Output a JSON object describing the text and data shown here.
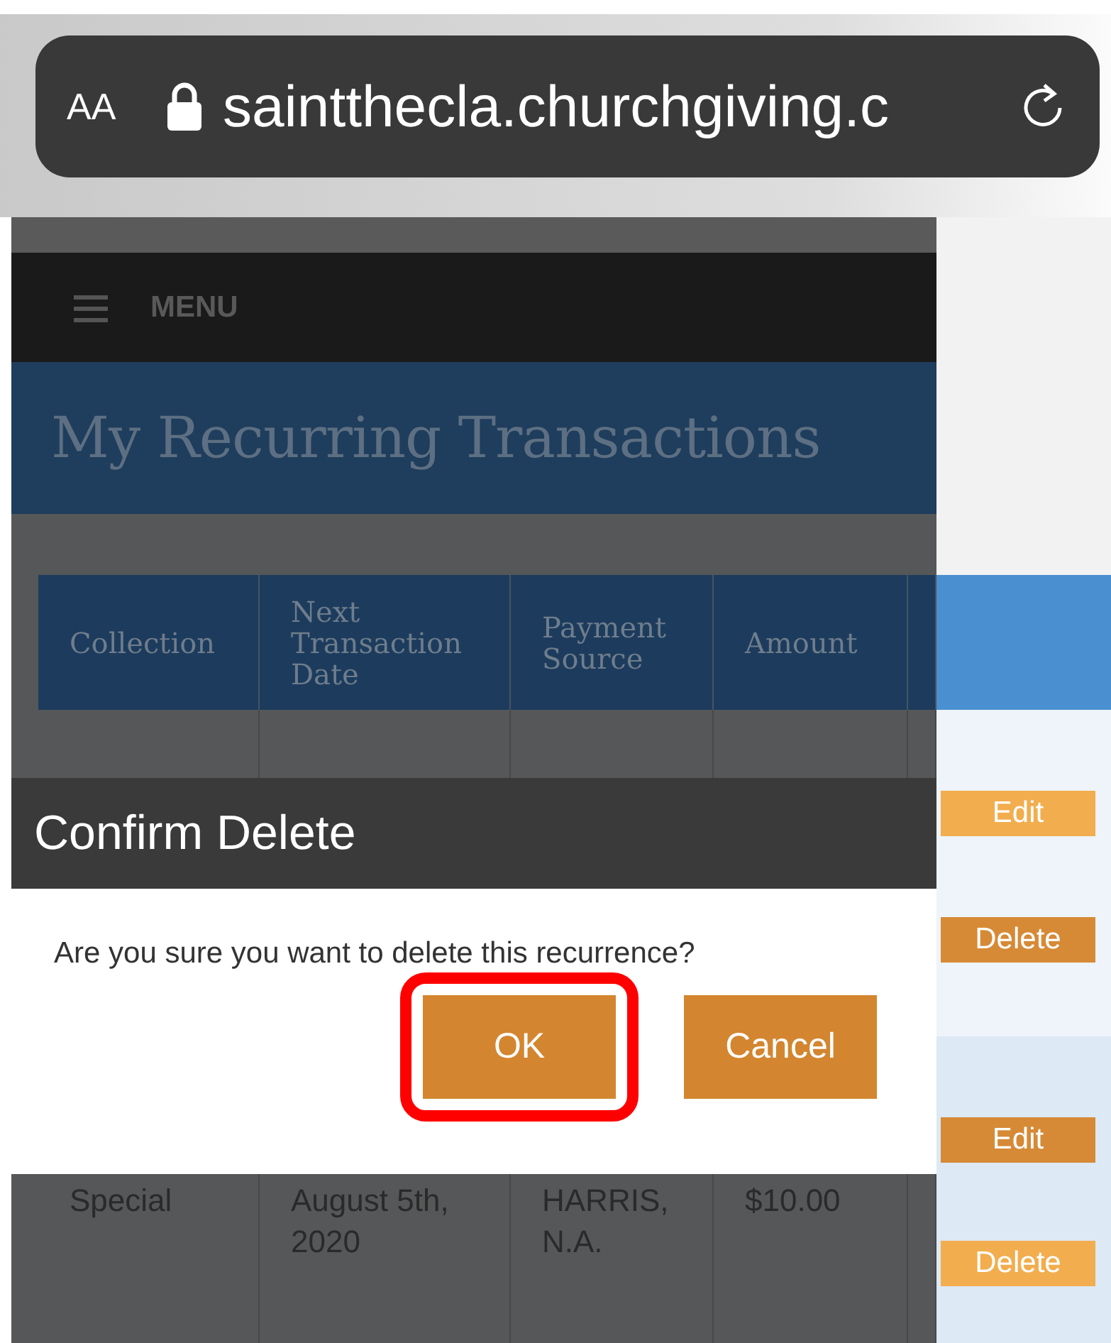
{
  "browser": {
    "text_size_button": "AA",
    "url": "saintthecla.churchgiving.c"
  },
  "menu": {
    "label": "MENU"
  },
  "page_title": "My Recurring Transactions",
  "table": {
    "columns": [
      "Collection",
      "Next Transaction Date",
      "Payment Source",
      "Amount"
    ],
    "rows": [
      {
        "cells": [
          "",
          "",
          "",
          ""
        ],
        "actions": [
          {
            "label": "Edit",
            "color": "#f2ad4e"
          },
          {
            "label": "Delete",
            "color": "#d68a36"
          }
        ]
      },
      {
        "cells": [
          "Special",
          "August 5th, 2020",
          "HARRIS, N.A.",
          "$10.00"
        ],
        "actions": [
          {
            "label": "Edit",
            "color": "#d68a36"
          },
          {
            "label": "Delete",
            "color": "#f2ad4e"
          }
        ]
      }
    ]
  },
  "dialog": {
    "title": "Confirm Delete",
    "message": "Are you sure you want to delete this recurrence?",
    "buttons": [
      {
        "label": "OK",
        "highlighted": true
      },
      {
        "label": "Cancel",
        "highlighted": false
      }
    ]
  }
}
